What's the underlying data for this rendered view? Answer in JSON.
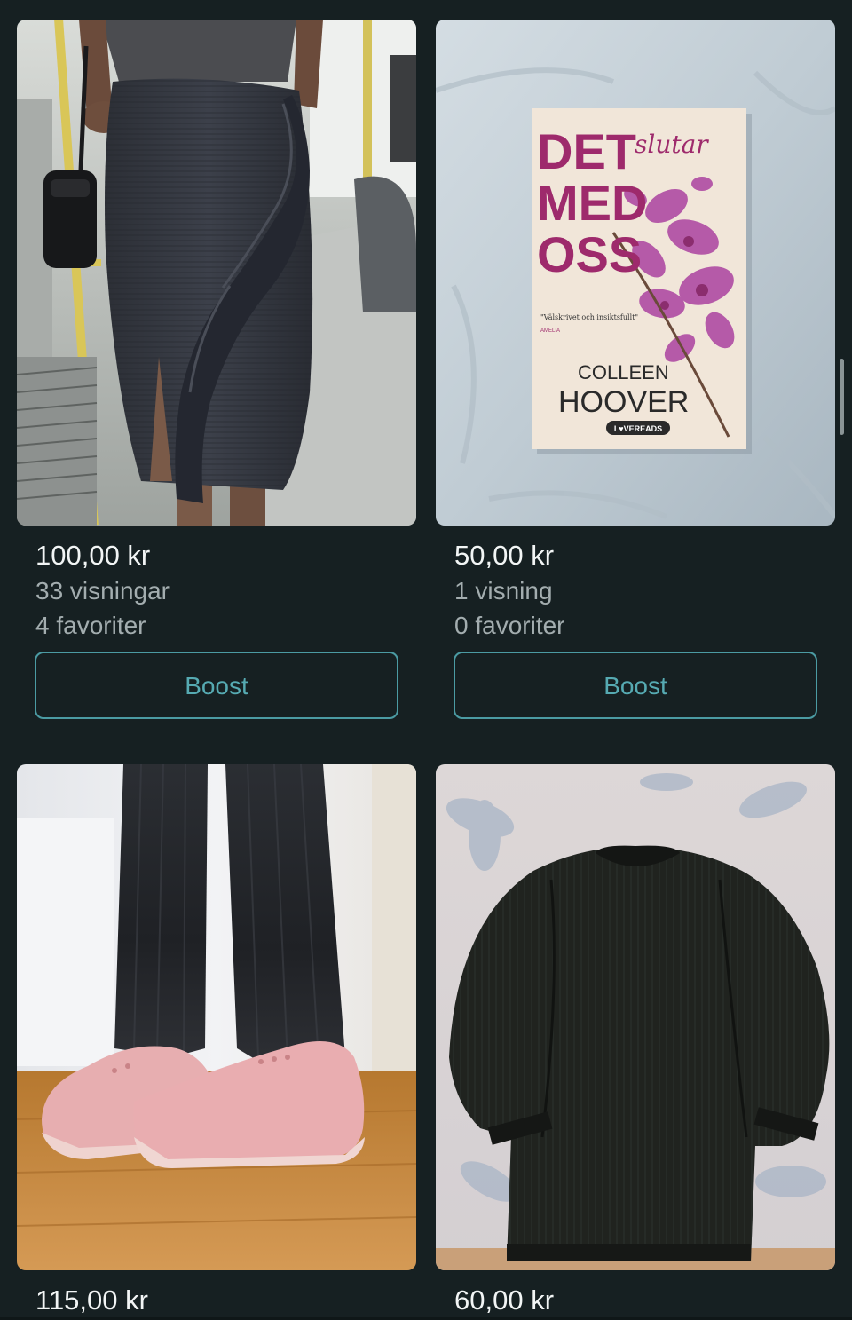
{
  "colors": {
    "background": "#162022",
    "accent": "#56aab2",
    "secondary_text": "#a3adaf"
  },
  "listings": [
    {
      "price": "100,00 kr",
      "views": "33 visningar",
      "favorites": "4 favoriter",
      "boost_label": "Boost",
      "photo": "black-ruffle-skirt-photo"
    },
    {
      "price": "50,00 kr",
      "views": "1 visning",
      "favorites": "0 favoriter",
      "boost_label": "Boost",
      "photo": "book-photo",
      "book": {
        "title_line1": "DET",
        "title_script": "slutar",
        "title_line2": "MED",
        "title_line3": "OSS",
        "quote": "\"Välskrivet och insiktsfullt\"",
        "quote_source": "AMELIA",
        "author_first": "COLLEEN",
        "author_last": "HOOVER",
        "publisher": "L♥VEREADS"
      }
    },
    {
      "price": "115,00 kr",
      "photo": "black-trousers-pink-sneakers-photo"
    },
    {
      "price": "60,00 kr",
      "photo": "black-knit-sweater-photo"
    }
  ]
}
